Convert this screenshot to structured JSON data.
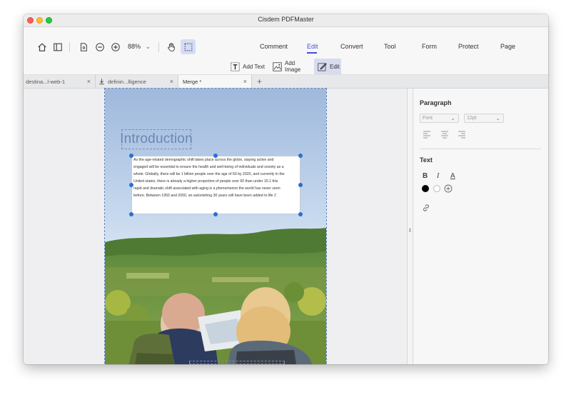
{
  "window": {
    "title": "Cisdem PDFMaster"
  },
  "toolbar": {
    "zoom": "88%",
    "menus": [
      {
        "label": "Comment",
        "active": false
      },
      {
        "label": "Edit",
        "active": true
      },
      {
        "label": "Convert",
        "active": false
      },
      {
        "label": "Tool",
        "active": false
      },
      {
        "label": "Form",
        "active": false
      },
      {
        "label": "Protect",
        "active": false
      },
      {
        "label": "Page",
        "active": false
      }
    ],
    "subtools": [
      {
        "label": "Add Text",
        "icon": "add-text-icon"
      },
      {
        "label": "Add Image",
        "icon": "add-image-icon"
      },
      {
        "label": "Edit",
        "icon": "edit-icon",
        "active": true
      }
    ],
    "icons": [
      "home-icon",
      "sidebar-icon",
      "page-icon",
      "zoom-out-icon",
      "zoom-in-icon",
      "hand-icon",
      "selection-icon"
    ]
  },
  "tabs": [
    {
      "label": "destina...l-web-1",
      "icon": ""
    },
    {
      "label": "definin...lligence",
      "icon": "download-icon"
    },
    {
      "label": "Merge *",
      "icon": "",
      "active": true
    }
  ],
  "document": {
    "heading": "Introduction",
    "paragraph": [
      "As the age-related demographic shift takes place across the globe, staying active and",
      "engaged will be essential to ensure the health and well-being of individuals and society as a",
      "whole. Globally, there will be 1 billion people over the age of 60 by 2020, and currently in the",
      "United states, there is already a higher proportion of people over 60 than under 15.1 this",
      "rapid and dramatic shift associated with aging is a phenomenon the world has never seen",
      "before. Between 1950 and 2050, an astonishing 30 years will have been added to life 2"
    ]
  },
  "panel": {
    "paragraph_title": "Paragraph",
    "font_placeholder": "Font",
    "size_placeholder": "12pt",
    "text_title": "Text",
    "bold": "B",
    "italic": "I",
    "underline": "A",
    "colors": {
      "black": "#000000",
      "white": "#ffffff"
    },
    "accent": "#4a4adb"
  }
}
